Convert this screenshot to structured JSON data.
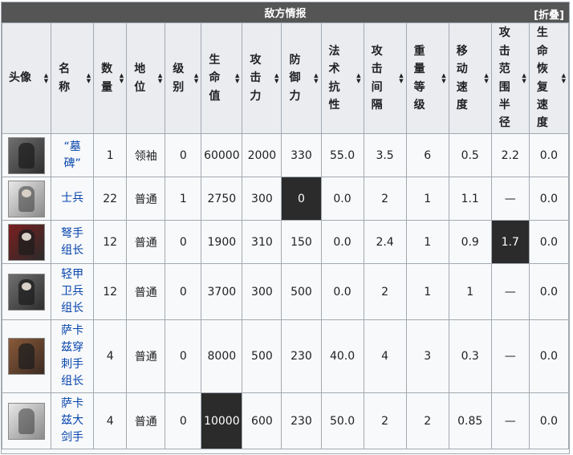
{
  "title": "敌方情报",
  "toggle_label": "[折叠]",
  "headers": [
    "头像",
    "名称",
    "数量",
    "地位",
    "级别",
    "生命值",
    "攻击力",
    "防御力",
    "法术抗性",
    "攻击间隔",
    "重量等级",
    "移动速度",
    "攻击范围半径",
    "生命恢复速度"
  ],
  "rows": [
    {
      "avatar": "grave-boss-avatar",
      "name": "“墓碑”",
      "count": "1",
      "status": "领袖",
      "level": "0",
      "hp": "60000",
      "atk": "2000",
      "def": "330",
      "res": "55.0",
      "interval": "3.5",
      "weight": "6",
      "speed": "0.5",
      "range": "2.2",
      "regen": "0.0"
    },
    {
      "avatar": "soldier-avatar",
      "name": "士兵",
      "count": "22",
      "status": "普通",
      "level": "1",
      "hp": "2750",
      "atk": "300",
      "def": "0",
      "res": "0.0",
      "interval": "2",
      "weight": "1",
      "speed": "1.1",
      "range": "—",
      "regen": "0.0"
    },
    {
      "avatar": "crossbow-leader-avatar",
      "name": "弩手组长",
      "count": "12",
      "status": "普通",
      "level": "0",
      "hp": "1900",
      "atk": "310",
      "def": "150",
      "res": "0.0",
      "interval": "2.4",
      "weight": "1",
      "speed": "0.9",
      "range": "1.7",
      "regen": "0.0"
    },
    {
      "avatar": "light-guard-leader-avatar",
      "name": "轻甲卫兵组长",
      "count": "12",
      "status": "普通",
      "level": "0",
      "hp": "3700",
      "atk": "300",
      "def": "500",
      "res": "0.0",
      "interval": "2",
      "weight": "1",
      "speed": "1",
      "range": "—",
      "regen": "0.0"
    },
    {
      "avatar": "sarkaz-piercer-leader-avatar",
      "name": "萨卡兹穿刺手组长",
      "count": "4",
      "status": "普通",
      "level": "0",
      "hp": "8000",
      "atk": "500",
      "def": "230",
      "res": "40.0",
      "interval": "4",
      "weight": "3",
      "speed": "0.3",
      "range": "—",
      "regen": "0.0"
    },
    {
      "avatar": "sarkaz-greatswordsman-avatar",
      "name": "萨卡兹大剑手",
      "count": "4",
      "status": "普通",
      "level": "0",
      "hp": "10000",
      "atk": "600",
      "def": "230",
      "res": "50.0",
      "interval": "2",
      "weight": "2",
      "speed": "0.85",
      "range": "—",
      "regen": "0.0"
    }
  ]
}
